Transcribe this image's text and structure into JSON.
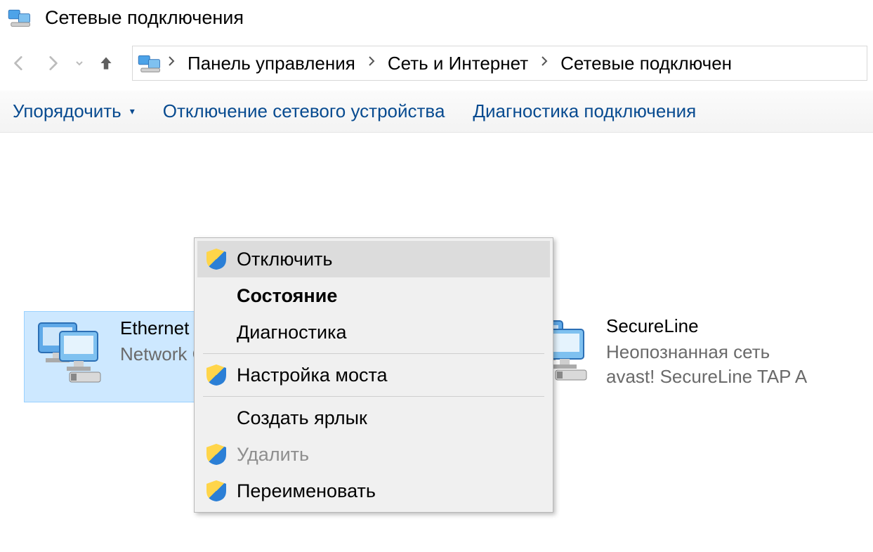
{
  "window": {
    "title": "Сетевые подключения"
  },
  "breadcrumb": {
    "items": [
      "Панель управления",
      "Сеть и Интернет",
      "Сетевые подключен"
    ]
  },
  "toolbar": {
    "organize": "Упорядочить",
    "disable_device": "Отключение сетевого устройства",
    "diagnose": "Диагностика подключения"
  },
  "connections": [
    {
      "name": "Ethernet",
      "status": "Network Connection",
      "detail": "",
      "selected": true
    },
    {
      "name": "SecureLine",
      "status": "Неопознанная сеть",
      "detail": "avast! SecureLine TAP A",
      "selected": false
    }
  ],
  "context_menu": {
    "items": [
      {
        "label": "Отключить",
        "shield": true,
        "hover": true
      },
      {
        "label": "Состояние",
        "bold": true
      },
      {
        "label": "Диагностика"
      },
      {
        "sep": true
      },
      {
        "label": "Настройка моста",
        "shield": true
      },
      {
        "sep": true
      },
      {
        "label": "Создать ярлык"
      },
      {
        "label": "Удалить",
        "shield": true,
        "disabled": true
      },
      {
        "label": "Переименовать",
        "shield": true
      }
    ]
  }
}
